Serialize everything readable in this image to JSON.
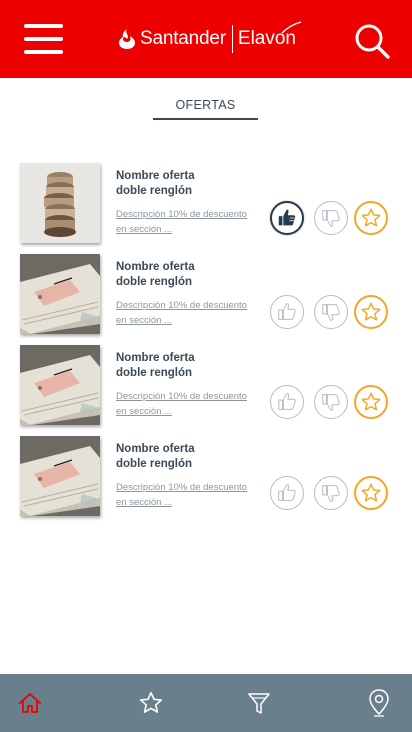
{
  "header": {
    "brand_name": "Santander",
    "partner_name": "Elavon",
    "menu_icon": "hamburger-menu-icon",
    "search_icon": "search-icon",
    "background_color": "#ec0000"
  },
  "tabs": [
    {
      "label": "OFERTAS",
      "active": true
    }
  ],
  "offers": [
    {
      "name_line1": "Nombre oferta",
      "name_line2": "doble renglón",
      "desc_line1": "Descripción 10% de descuento",
      "desc_line2": "en sección ...",
      "image": "bread-slices",
      "liked": true
    },
    {
      "name_line1": "Nombre oferta",
      "name_line2": "doble renglón",
      "desc_line1": "Descripción 10% de descuento",
      "desc_line2": "en sección ...",
      "image": "phone-on-books",
      "liked": false
    },
    {
      "name_line1": "Nombre oferta",
      "name_line2": "doble renglón",
      "desc_line1": "Descripción 10% de descuento",
      "desc_line2": "en sección ...",
      "image": "phone-on-books",
      "liked": false
    },
    {
      "name_line1": "Nombre oferta",
      "name_line2": "doble renglón",
      "desc_line1": "Descripción 10% de descuento",
      "desc_line2": "en sección ...",
      "image": "phone-on-books",
      "liked": false
    }
  ],
  "bottom_nav": {
    "items": [
      {
        "icon": "home-icon",
        "active": true
      },
      {
        "icon": "star-icon",
        "active": false
      },
      {
        "icon": "filter-icon",
        "active": false
      },
      {
        "icon": "location-pin-icon",
        "active": false
      }
    ],
    "background_color": "#69808c",
    "active_color": "#ec0000"
  },
  "colors": {
    "text_dark": "#3b4a57",
    "favorite_accent": "#f5a623",
    "like_active": "#273a4c"
  }
}
